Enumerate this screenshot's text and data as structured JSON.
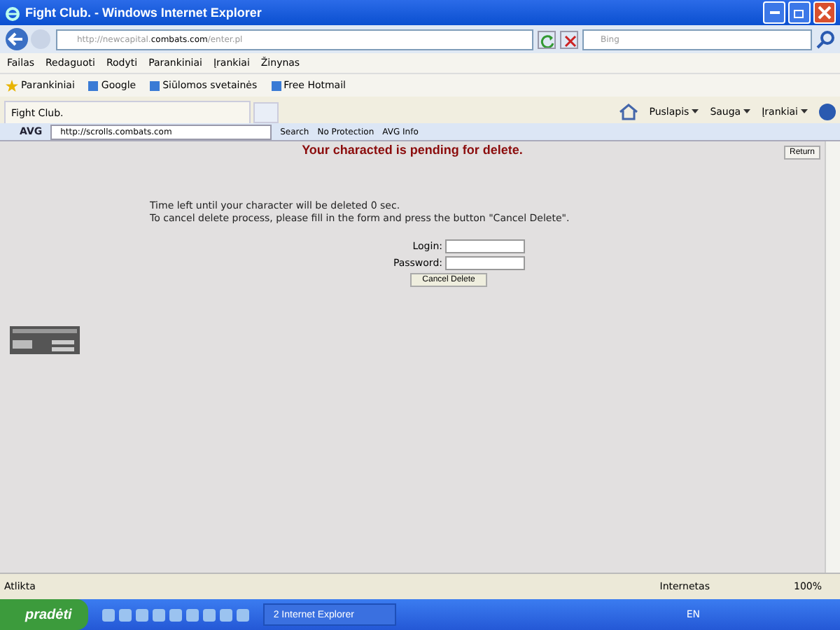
{
  "window": {
    "title": "Fight Club. - Windows Internet Explorer"
  },
  "address_bar": {
    "url_prefix": "http://newcapital.",
    "url_domain": "combats.com",
    "url_suffix": "/enter.pl",
    "search_placeholder": "Bing"
  },
  "menu": [
    "Failas",
    "Redaguoti",
    "Rodyti",
    "Parankiniai",
    "Įrankiai",
    "Žinynas"
  ],
  "favorites_bar": {
    "favorites": "Parankiniai",
    "links": [
      "Google",
      "Siūlomos svetainės",
      "Free Hotmail"
    ]
  },
  "tabs": [
    {
      "label": "Fight Club.",
      "selected": true
    }
  ],
  "command_bar": [
    "Puslapis",
    "Sauga",
    "Įrankiai"
  ],
  "avg_toolbar": {
    "brand": "AVG",
    "url": "http://scrolls.combats.com",
    "buttons": [
      "Search",
      "No Protection",
      "AVG Info"
    ]
  },
  "page": {
    "heading": "Your characted is pending for delete.",
    "return_button": "Return",
    "lines": [
      "Time left until your character will be deleted 0 sec.",
      "To cancel delete process, please fill in the form and press the button \"Cancel Delete\"."
    ],
    "fields": [
      {
        "label": "Login:"
      },
      {
        "label": "Password:"
      }
    ],
    "submit": "Cancel Delete"
  },
  "status_bar": {
    "status": "Atlikta",
    "zone": "Internetas",
    "zoom": "100%"
  },
  "taskbar": {
    "start": "pradėti",
    "task": "2 Internet Explorer",
    "language": "EN"
  }
}
